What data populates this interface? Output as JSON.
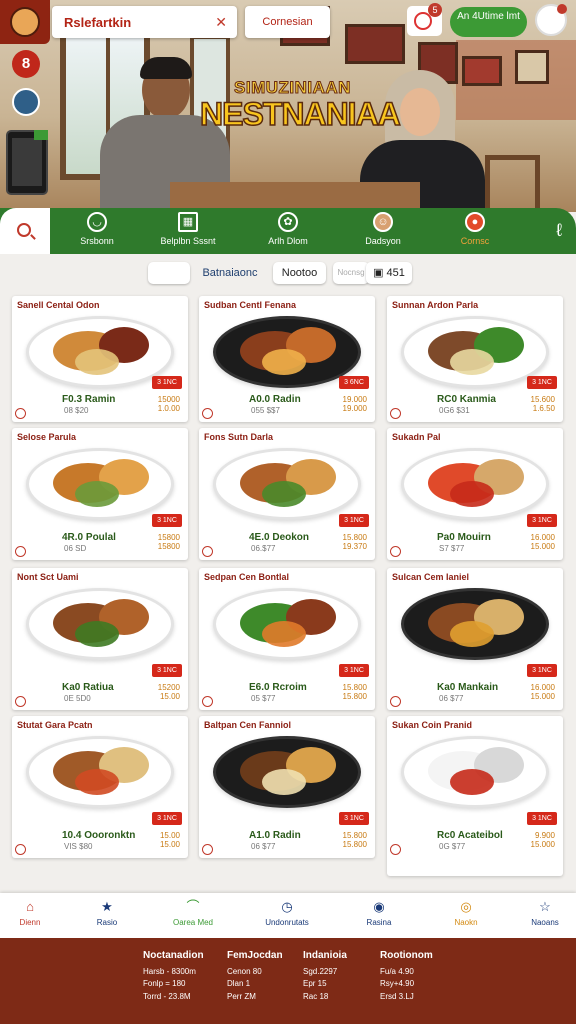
{
  "header": {
    "search_text": "Rslefartkin",
    "cuisine_label": "Cornesian",
    "notif_count": "5",
    "cta_label": "An 4Utime lmt",
    "rail_initial": "8"
  },
  "hero": {
    "subtitle": "SIMUZINIAAN",
    "title": "NESTNANIAA"
  },
  "categories": [
    {
      "label": "Srsbonn",
      "icon": "bowl-icon"
    },
    {
      "label": "Belplbn Sssnt",
      "icon": "grid-icon"
    },
    {
      "label": "Arlh Dlom",
      "icon": "dish-icon"
    },
    {
      "label": "Dadsyon",
      "icon": "chef-icon"
    },
    {
      "label": "Cornsc",
      "icon": "promo-icon",
      "active": true
    }
  ],
  "filters": {
    "chip_blank": "",
    "sort_label": "Batnaiaonc",
    "chip_mid": "Nootoo",
    "chip_grey": "Nocnsg",
    "count_label": "451"
  },
  "menu_items": [
    {
      "title": "Sanell Cental Odon",
      "name": "F0.3 Ramin",
      "sub": "08 $20",
      "price1": "15000",
      "price2": "1.0.00",
      "tag": "3 1NC"
    },
    {
      "title": "Sudban Centl Fenana",
      "name": "A0.0 Radin",
      "sub": "055 $$7",
      "price1": "19.000",
      "price2": "19.000",
      "tag": "3 6NC"
    },
    {
      "title": "Sunnan Ardon Parla",
      "name": "RC0 Kanmia",
      "sub": "0G6 $31",
      "price1": "15.600",
      "price2": "1.6.50",
      "tag": "3 1NC"
    },
    {
      "title": "Selose Parula",
      "name": "4R.0 Poulal",
      "sub": "06 SD",
      "price1": "15800",
      "price2": "15800",
      "tag": "3 1NC"
    },
    {
      "title": "Fons Sutn Darla",
      "name": "4E.0 Deokon",
      "sub": "06.$77",
      "price1": "15.800",
      "price2": "19.370",
      "tag": "3 1NC"
    },
    {
      "title": "Sukadn Pal",
      "name": "Pa0 Mouirn",
      "sub": "S7 $77",
      "price1": "16.000",
      "price2": "15.000",
      "tag": "3 1NC"
    },
    {
      "title": "Nont Sct Uami",
      "name": "Ka0 Ratiua",
      "sub": "0E 5D0",
      "price1": "15200",
      "price2": "15.00",
      "tag": "3 1NC"
    },
    {
      "title": "Sedpan Cen Bontlal",
      "name": "E6.0 Rcroim",
      "sub": "05 $77",
      "price1": "15.800",
      "price2": "15.800",
      "tag": "3 1NC"
    },
    {
      "title": "Sulcan Cem Ianiel",
      "name": "Ka0 Mankain",
      "sub": "06 $77",
      "price1": "16.000",
      "price2": "15.000",
      "tag": "3 1NC"
    },
    {
      "title": "Stutat Gara Pcatn",
      "name": "10.4 Oooronktn",
      "sub": "VIS $80",
      "price1": "15.00",
      "price2": "15.00",
      "tag": "3 1NC"
    },
    {
      "title": "Baltpan Cen Fanniol",
      "name": "A1.0 Radin",
      "sub": "06 $77",
      "price1": "15.800",
      "price2": "15.800",
      "tag": "3 1NC"
    },
    {
      "title": "Sukan Coin Pranid",
      "name": "Rc0 Acateibol",
      "sub": "0G $77",
      "price1": "9.900",
      "price2": "15.000",
      "tag": "3 1NC"
    }
  ],
  "bottom_nav": [
    {
      "label": "Dienn",
      "icon": "home-icon",
      "active": true
    },
    {
      "label": "Rasio",
      "icon": "star-icon"
    },
    {
      "label": "Oarea Med",
      "icon": "map-icon"
    },
    {
      "label": "Undonrutats",
      "icon": "clock-icon"
    },
    {
      "label": "Rasina",
      "icon": "bell-icon"
    },
    {
      "label": "Naokn",
      "icon": "coin-icon"
    },
    {
      "label": "Naoans",
      "icon": "star-outline-icon"
    }
  ],
  "footer": [
    {
      "heading": "Noctanadion",
      "lines": [
        "Harsb - 8300m",
        "Fonlp = 180",
        "Torrd - 23.8M"
      ]
    },
    {
      "heading": "FemJocdan",
      "lines": [
        "Cenon 80",
        "Dlan 1",
        "Perr ZM"
      ]
    },
    {
      "heading": "Indanioia",
      "lines": [
        "Sgd.2297",
        "Epr 15",
        "Rac 18"
      ]
    },
    {
      "heading": "Rootionom",
      "lines": [
        "Fu/a 4.90",
        "Rsy+4.90",
        "Ersd 3.LJ"
      ]
    }
  ],
  "colors": {
    "brand_red": "#8e2412",
    "nav_green": "#2f7a2c",
    "price_orange": "#c87a12",
    "footer_bg": "#7e2a16"
  }
}
